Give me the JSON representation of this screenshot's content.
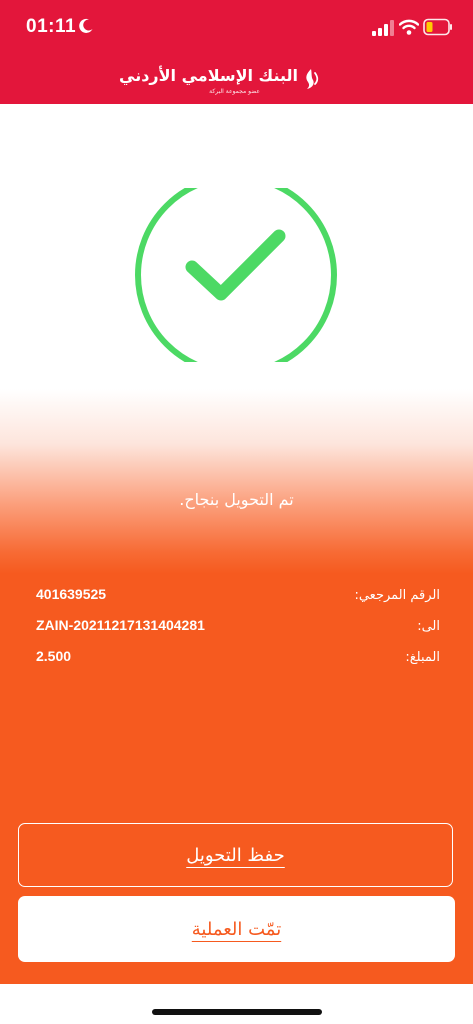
{
  "status_bar": {
    "time": "01:11",
    "moon_icon": "moon-icon",
    "signal_icon": "cellular-signal-icon",
    "wifi_icon": "wifi-icon",
    "battery_icon": "battery-low-icon"
  },
  "header": {
    "bank_name": "البنك الإسلامي الأردني",
    "bank_tagline": "عضو مجموعة البركة",
    "logo_icon": "bank-logo-icon",
    "color": "#e3163b"
  },
  "result": {
    "status_icon": "check-circle-icon",
    "message": "تم التحويل بنجاح."
  },
  "details": [
    {
      "label": "الرقم المرجعي:",
      "value": "401639525"
    },
    {
      "label": "الى:",
      "value": "ZAIN-20211217131404281"
    },
    {
      "label": "المبلغ:",
      "value": "2.500"
    }
  ],
  "actions": {
    "save_label": "حفظ التحويل",
    "done_label": "تمّت العملية"
  },
  "colors": {
    "accent": "#f65a1f",
    "success_green": "#4cd964"
  }
}
